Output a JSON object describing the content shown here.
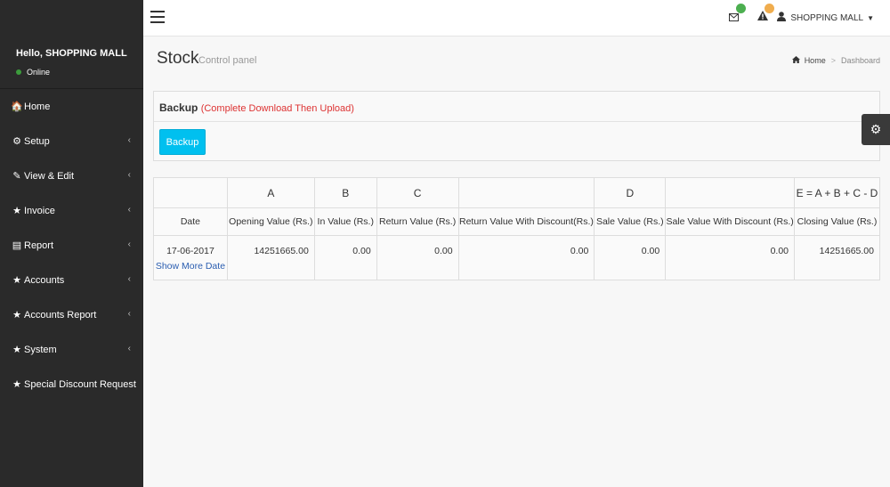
{
  "sidebar": {
    "greeting": "Hello, SHOPPING MALL",
    "status": "Online",
    "items": [
      {
        "label": "Home",
        "icon": "home-icon",
        "glyph": "🏠",
        "has_children": false
      },
      {
        "label": "Setup",
        "icon": "cogs-icon",
        "glyph": "⚙",
        "has_children": true
      },
      {
        "label": "View & Edit",
        "icon": "edit-icon",
        "glyph": "✎",
        "has_children": true
      },
      {
        "label": "Invoice",
        "icon": "star-icon",
        "glyph": "★",
        "has_children": true
      },
      {
        "label": "Report",
        "icon": "file-icon",
        "glyph": "▤",
        "has_children": true
      },
      {
        "label": "Accounts",
        "icon": "star-icon",
        "glyph": "★",
        "has_children": true
      },
      {
        "label": "Accounts Report",
        "icon": "star-icon",
        "glyph": "★",
        "has_children": true
      },
      {
        "label": "System",
        "icon": "star-icon",
        "glyph": "★",
        "has_children": true
      },
      {
        "label": "Special Discount Request",
        "icon": "star-icon",
        "glyph": "★",
        "has_children": false
      }
    ]
  },
  "header": {
    "user": "SHOPPING MALL",
    "badge_colors": {
      "mail": "#4caf50",
      "alert": "#f0ad4e"
    }
  },
  "page": {
    "title": "Stock",
    "subtitle": "Control panel",
    "breadcrumb": [
      "Home",
      "Dashboard"
    ]
  },
  "backup": {
    "title": "Backup",
    "note": "(Complete Download Then Upload)",
    "button": "Backup"
  },
  "table": {
    "group_headers": [
      "",
      "A",
      "B",
      "C",
      "",
      "D",
      "",
      "E = A + B + C - D"
    ],
    "columns": [
      "Date",
      "Opening Value (Rs.)",
      "In Value (Rs.)",
      "Return Value (Rs.)",
      "Return Value With Discount(Rs.)",
      "Sale Value (Rs.)",
      "Sale Value With Discount (Rs.)",
      "Closing Value (Rs.)"
    ],
    "rows": [
      {
        "date": "17-06-2017",
        "link": "Show More Date",
        "values": [
          "14251665.00",
          "0.00",
          "0.00",
          "0.00",
          "0.00",
          "0.00",
          "14251665.00"
        ]
      }
    ]
  }
}
